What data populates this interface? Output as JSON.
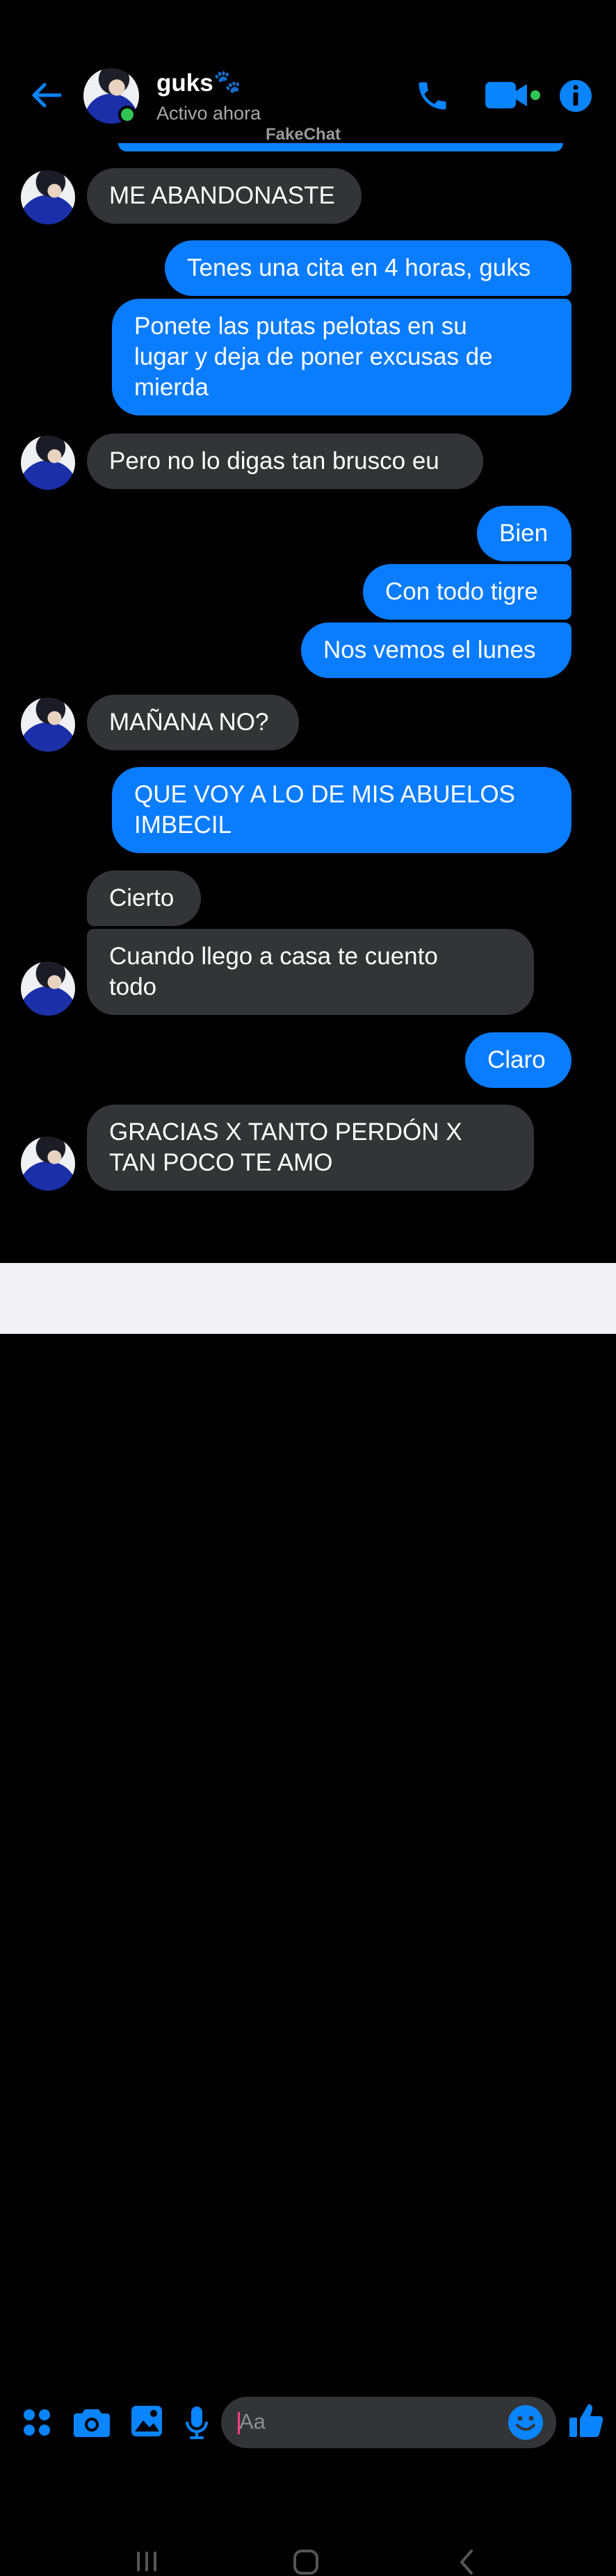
{
  "header": {
    "contact_name": "guks",
    "name_emoji": "🐾",
    "status": "Activo ahora",
    "watermark": "FakeChat",
    "icons": [
      "back-arrow-icon",
      "phone-icon",
      "video-camera-icon",
      "info-icon"
    ]
  },
  "colors": {
    "accent": "#0a7cff",
    "incoming_bubble": "#333436",
    "online": "#31c653",
    "background": "#000000"
  },
  "messages": [
    {
      "from": "contact",
      "text": "ME ABANDONASTE"
    },
    {
      "from": "me",
      "text": "Tenes una cita en 4 horas, guks"
    },
    {
      "from": "me",
      "text": "Ponete las putas pelotas en su\nlugar y deja de poner excusas de\nmierda"
    },
    {
      "from": "contact",
      "text": "Pero no lo digas tan brusco eu"
    },
    {
      "from": "me",
      "text": "Bien"
    },
    {
      "from": "me",
      "text": "Con todo tigre"
    },
    {
      "from": "me",
      "text": "Nos vemos el lunes"
    },
    {
      "from": "contact",
      "text": "MAÑANA NO?"
    },
    {
      "from": "me",
      "text": "QUE VOY A LO DE MIS ABUELOS\nIMBECIL"
    },
    {
      "from": "contact",
      "text": "Cierto"
    },
    {
      "from": "contact",
      "text": "Cuando llego a casa te cuento\ntodo"
    },
    {
      "from": "me",
      "text": "Claro"
    },
    {
      "from": "contact",
      "text": "GRACIAS X TANTO PERDÓN X\nTAN POCO TE AMO"
    }
  ],
  "composer": {
    "placeholder": "Aa",
    "icons": [
      "apps-icon",
      "camera-icon",
      "gallery-icon",
      "microphone-icon",
      "emoji-icon",
      "thumbs-up-icon"
    ]
  },
  "navigation": {
    "icons": [
      "recent-apps-icon",
      "home-icon",
      "back-icon"
    ]
  }
}
